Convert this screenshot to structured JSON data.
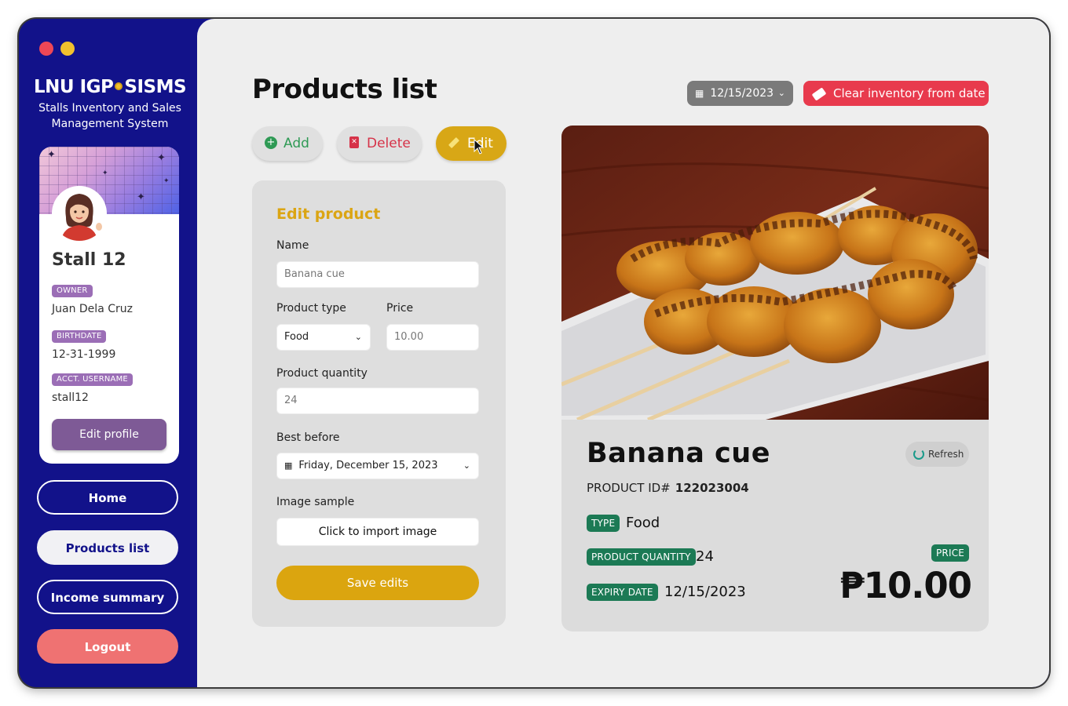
{
  "app": {
    "title": "LNU IGP",
    "title_suffix": "SISMS",
    "subtitle_line1": "Stalls Inventory and Sales",
    "subtitle_line2": "Management System"
  },
  "profile": {
    "stall_name": "Stall 12",
    "owner_label": "OWNER",
    "owner": "Juan Dela Cruz",
    "birthdate_label": "BIRTHDATE",
    "birthdate": "12-31-1999",
    "username_label": "ACCT. USERNAME",
    "username": "stall12",
    "edit_label": "Edit profile"
  },
  "nav": {
    "home": "Home",
    "products": "Products list",
    "income": "Income summary",
    "logout": "Logout"
  },
  "page": {
    "title": "Products list",
    "date_filter": "12/15/2023",
    "clear_label": "Clear inventory from date"
  },
  "actions": {
    "add": "Add",
    "delete": "Delete",
    "edit": "Edit"
  },
  "form": {
    "title": "Edit product",
    "name_label": "Name",
    "name_value": "Banana cue",
    "type_label": "Product type",
    "type_value": "Food",
    "price_label": "Price",
    "price_value": "10.00",
    "qty_label": "Product quantity",
    "qty_value": "24",
    "best_before_label": "Best before",
    "best_before_value": "Friday, December 15, 2023",
    "image_label": "Image sample",
    "import_label": "Click to import image",
    "save_label": "Save edits"
  },
  "product": {
    "name": "Banana cue",
    "refresh_label": "Refresh",
    "id_label": "PRODUCT ID#",
    "id_value": "122023004",
    "type_tag": "TYPE",
    "type_value": "Food",
    "qty_tag": "PRODUCT QUANTITY",
    "qty_value": "24",
    "expiry_tag": "EXPIRY DATE",
    "expiry_value": "12/15/2023",
    "price_tag": "PRICE",
    "price_value": "₱10.00"
  },
  "colors": {
    "sidebar": "#12128a",
    "accent_yellow": "#dba513",
    "danger": "#e83a4d",
    "success_tag": "#1c7a55",
    "profile_tag": "#9b6eb6"
  }
}
